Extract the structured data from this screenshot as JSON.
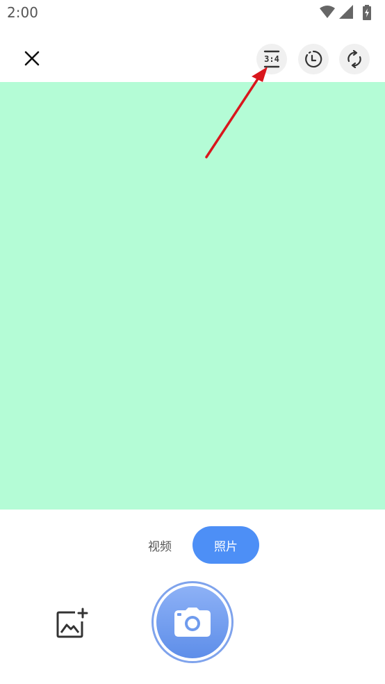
{
  "status_bar": {
    "time": "2:00",
    "icons": [
      "wifi-icon",
      "signal-icon",
      "battery-charging-icon"
    ]
  },
  "top_bar": {
    "close_icon": "close-icon",
    "aspect_ratio_label": "3:4",
    "timer_icon": "timer-icon",
    "flip_icon": "flip-camera-icon"
  },
  "preview": {
    "background_color": "#b4fcd6"
  },
  "annotation": {
    "arrow_color": "#d9161c"
  },
  "mode_switch": {
    "video_label": "视频",
    "photo_label": "照片",
    "selected": "照片",
    "accent_color": "#4d8ff6"
  },
  "bottom_controls": {
    "gallery_icon": "gallery-add-icon",
    "shutter_icon": "camera-icon"
  }
}
